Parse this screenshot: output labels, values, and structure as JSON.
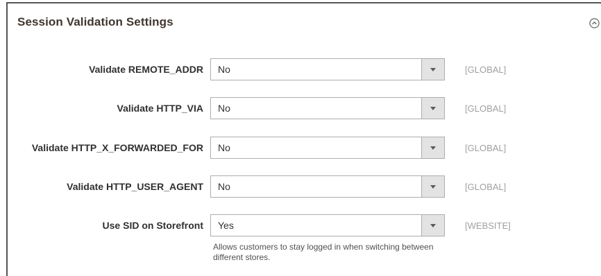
{
  "section": {
    "title": "Session Validation Settings"
  },
  "rows": [
    {
      "label": "Validate REMOTE_ADDR",
      "value": "No",
      "scope": "[GLOBAL]"
    },
    {
      "label": "Validate HTTP_VIA",
      "value": "No",
      "scope": "[GLOBAL]"
    },
    {
      "label": "Validate HTTP_X_FORWARDED_FOR",
      "value": "No",
      "scope": "[GLOBAL]"
    },
    {
      "label": "Validate HTTP_USER_AGENT",
      "value": "No",
      "scope": "[GLOBAL]"
    },
    {
      "label": "Use SID on Storefront",
      "value": "Yes",
      "scope": "[WEBSITE]"
    }
  ],
  "note": "Allows customers to stay logged in when switching between different stores.",
  "icons": {
    "collapse": "chevron-up-circle-icon",
    "dropdown": "chevron-down-icon"
  },
  "colors": {
    "title": "#41362f",
    "scope": "#a0a0a0",
    "select_border": "#adadad",
    "arrow_box": "#e3e3e3"
  }
}
